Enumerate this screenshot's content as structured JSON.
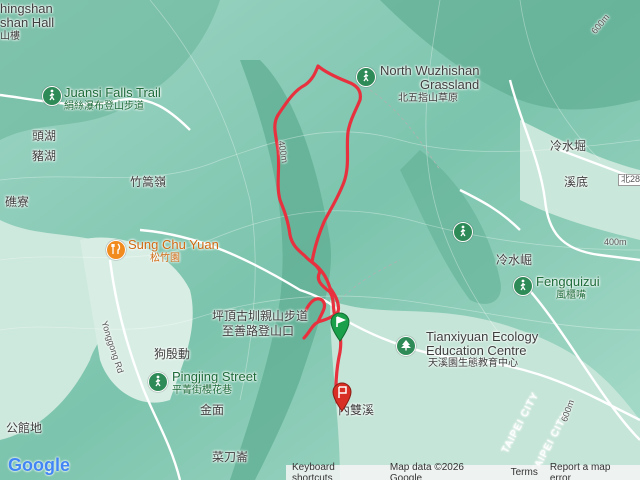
{
  "map": {
    "labels": {
      "top_left_1": "hingshan",
      "top_left_2": "shan Hall",
      "top_left_3": "山樓",
      "juansi_en": "Juansi Falls Trail",
      "juansi_zh": "絹絲瀑布登山步道",
      "toohu": "頭湖",
      "zhuhu": "豬湖",
      "zhugaoling": "竹篙嶺",
      "boliao": "礁寮",
      "sungchuyuan_en": "Sung Chu Yuan",
      "sungchuyuan_zh": "松竹園",
      "yonggong_rd": "Yonggong Rd",
      "pingding_zh_1": "坪頂古圳親山步道",
      "pingding_zh_2": "至善路登山口",
      "goudian": "狗殷動",
      "pingjing_en": "Pingjing Street",
      "pingjing_zh": "平菁街櫻花巷",
      "jinmian": "金面",
      "gongguandi": "公館地",
      "caidaoyi": "菜刀崙",
      "shuangxi": "內雙溪",
      "wuzhi_en_1": "North Wuzhishan",
      "wuzhi_en_2": "Grassland",
      "wuzhi_zh": "北五指山草原",
      "lengshuijue": "冷水堀",
      "xidi": "溪底",
      "bei28": "北28",
      "fengqui_en": "Fengquizui",
      "fengqui_zh": "風櫃嘴",
      "lengshuikeng": "冷水崛",
      "tianxiyuan_en_1": "Tianxiyuan Ecology",
      "tianxiyuan_en_2": "Education Centre",
      "tianxiyuan_zh": "天溪園生態教育中心",
      "taipei_1": "TAIPEI CITY",
      "taipei_2": "TAIPEI CITY",
      "contour_1": "400m",
      "contour_2": "600m",
      "contour_3": "400m",
      "contour_4": "600m"
    },
    "footer": {
      "shortcuts": "Keyboard shortcuts",
      "data": "Map data ©2026 Google",
      "scale": "200 m",
      "terms": "Terms",
      "report": "Report a map error"
    },
    "brand": "Google",
    "colors": {
      "track": "#e8313f",
      "terrain_light": "#cfe8dd",
      "terrain_dark": "#4a9f82",
      "poi_green": "#2e8b57",
      "poi_orange": "#f28b1e"
    },
    "icons": {
      "start": "start-flag-icon",
      "end": "end-pin-icon",
      "trail": "hiker-icon",
      "tree": "park-icon",
      "food": "restaurant-icon"
    }
  }
}
